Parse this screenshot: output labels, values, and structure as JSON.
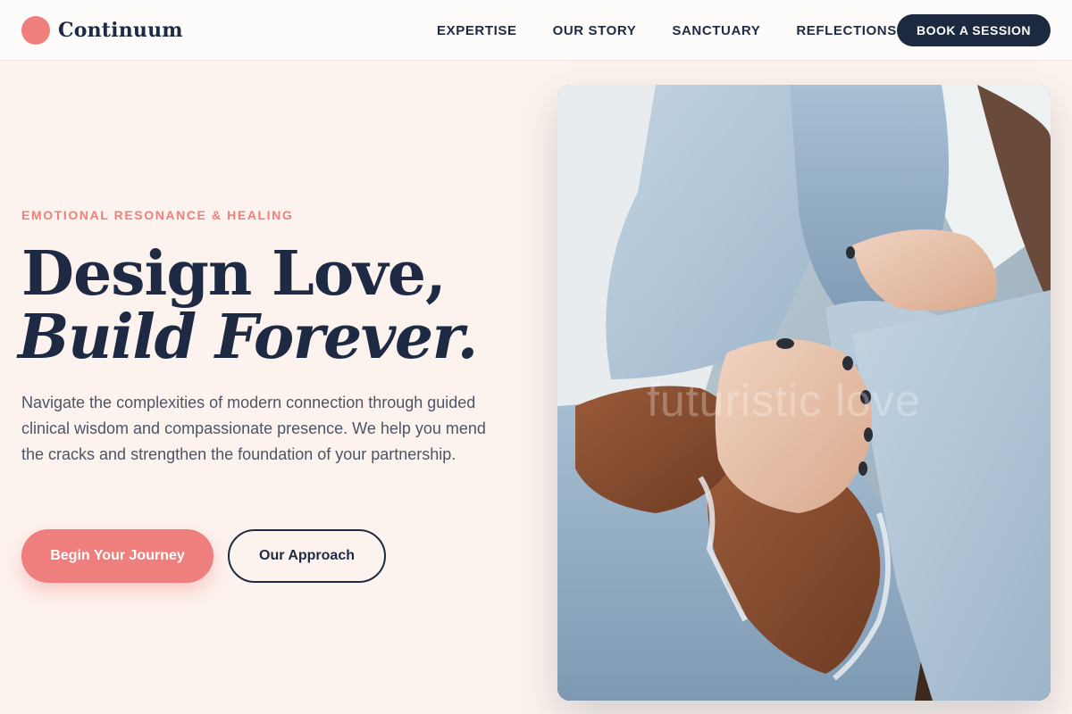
{
  "brand": {
    "name": "Continuum",
    "accent": "#ef7f7c",
    "ink": "#1e2a44"
  },
  "nav": {
    "items": [
      "EXPERTISE",
      "OUR STORY",
      "SANCTUARY",
      "REFLECTIONS"
    ],
    "cta": "BOOK A SESSION"
  },
  "hero": {
    "eyebrow": "EMOTIONAL RESONANCE & HEALING",
    "title_line1": "Design Love,",
    "title_line2": "Build Forever.",
    "lede": "Navigate the complexities of modern connection through guided clinical wisdom and compassionate presence. We help you mend the cracks and strengthen the foundation of your partnership.",
    "primary_button": "Begin Your Journey",
    "secondary_button": "Our Approach",
    "image_watermark": "futuristic love"
  }
}
